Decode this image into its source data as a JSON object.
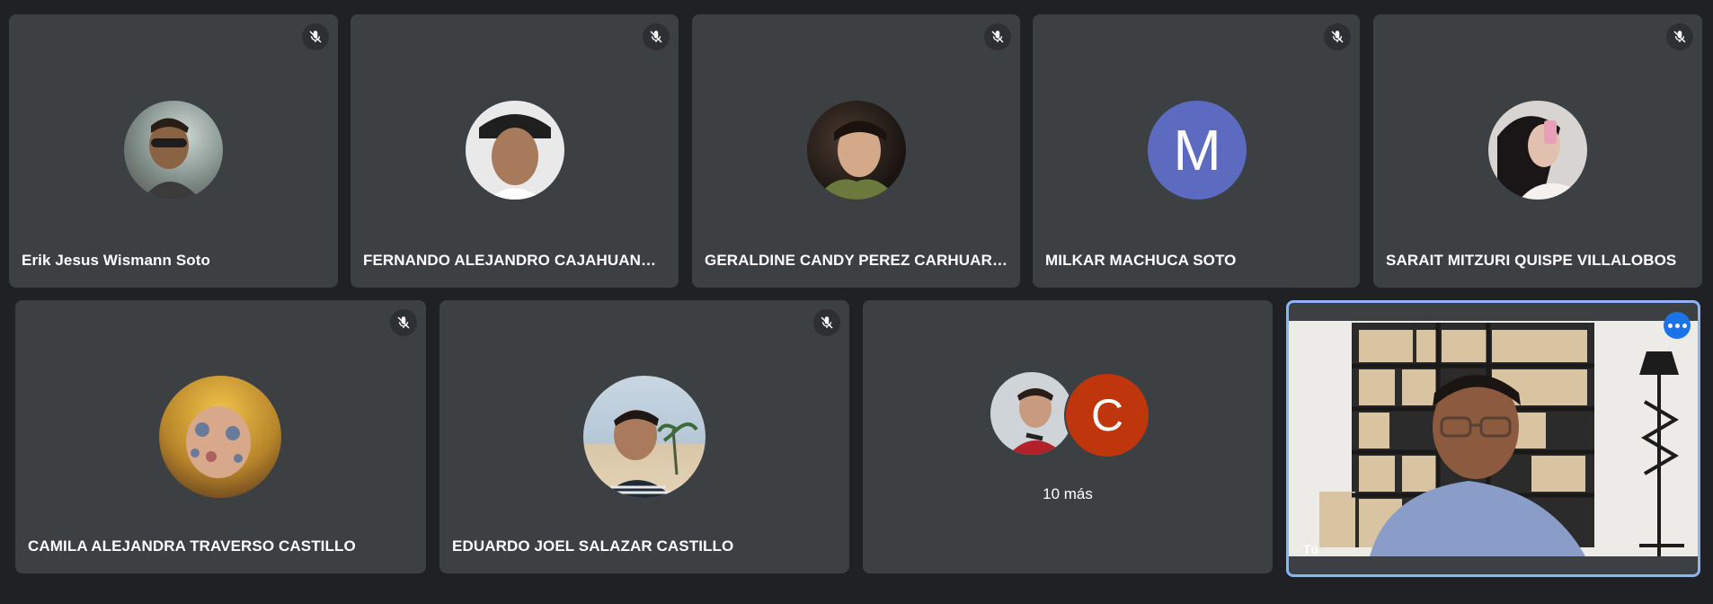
{
  "colors": {
    "background": "#202124",
    "tile": "#3c4043",
    "self_border": "#8ab4f8",
    "milkar_avatar": "#5c6bc0",
    "c_avatar": "#bf360c"
  },
  "participants_row1": [
    {
      "name": "Erik Jesus Wismann Soto",
      "muted": true
    },
    {
      "name": "FERNANDO ALEJANDRO CAJAHUANCA...",
      "muted": true
    },
    {
      "name": "GERALDINE CANDY PEREZ CARHUARIC...",
      "muted": true
    },
    {
      "name": "MILKAR MACHUCA SOTO",
      "muted": true,
      "avatar_letter": "M"
    },
    {
      "name": "SARAIT MITZURI QUISPE VILLALOBOS",
      "muted": true
    }
  ],
  "participants_row2": [
    {
      "name": "CAMILA ALEJANDRA TRAVERSO CASTILLO",
      "muted": true
    },
    {
      "name": "EDUARDO JOEL SALAZAR CASTILLO",
      "muted": true
    }
  ],
  "overflow_tile": {
    "avatar_letter": "C",
    "label": "10 más"
  },
  "self_tile": {
    "label": "Tú"
  }
}
